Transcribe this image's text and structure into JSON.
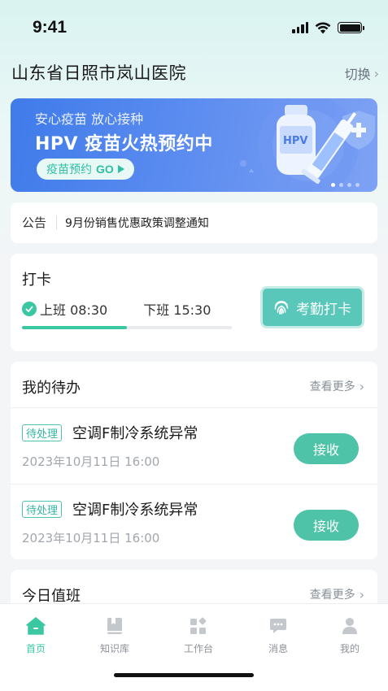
{
  "status_bar": {
    "time": "9:41"
  },
  "header": {
    "hospital_name": "山东省日照市岚山医院",
    "switch_label": "切换"
  },
  "banner": {
    "subtitle": "安心疫苗 放心接种",
    "title": "HPV 疫苗火热预约中",
    "button_label": "疫苗预约",
    "button_go": "GO",
    "vial_label": "HPV",
    "slide_count": 4,
    "active_slide": 1
  },
  "notice": {
    "tag": "公告",
    "text": "9月份销售优惠政策调整通知"
  },
  "checkin": {
    "title": "打卡",
    "on_duty": "上班 08:30",
    "off_duty": "下班 15:30",
    "progress": 0.5,
    "button_label": "考勤打卡"
  },
  "todo": {
    "title": "我的待办",
    "more_label": "查看更多",
    "items": [
      {
        "status": "待处理",
        "title": "空调F制冷系统异常",
        "time": "2023年10月11日 16:00",
        "action": "接收"
      },
      {
        "status": "待处理",
        "title": "空调F制冷系统异常",
        "time": "2023年10月11日 16:00",
        "action": "接收"
      }
    ]
  },
  "duty": {
    "title": "今日值班",
    "more_label": "查看更多"
  },
  "tabbar": {
    "tabs": [
      {
        "label": "首页",
        "icon": "home-icon",
        "active": true
      },
      {
        "label": "知识库",
        "icon": "book-icon",
        "active": false
      },
      {
        "label": "工作台",
        "icon": "grid-icon",
        "active": false
      },
      {
        "label": "消息",
        "icon": "message-icon",
        "active": false
      },
      {
        "label": "我的",
        "icon": "user-icon",
        "active": false
      }
    ]
  },
  "colors": {
    "accent": "#3cc7a3",
    "banner": "#4a82ec",
    "muted": "#8d9399"
  }
}
